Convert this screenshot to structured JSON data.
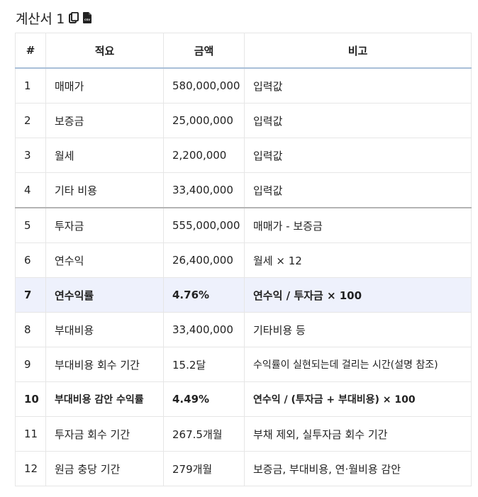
{
  "title": "계산서 1",
  "icons": {
    "copy": "copy-icon",
    "csv": "csv-file-icon",
    "csv_text": "CSV"
  },
  "columns": [
    "#",
    "적요",
    "금액",
    "비고"
  ],
  "rows": [
    {
      "no": "1",
      "item": "매매가",
      "amount": "580,000,000",
      "note": "입력값"
    },
    {
      "no": "2",
      "item": "보증금",
      "amount": "25,000,000",
      "note": "입력값"
    },
    {
      "no": "3",
      "item": "월세",
      "amount": "2,200,000",
      "note": "입력값"
    },
    {
      "no": "4",
      "item": "기타 비용",
      "amount": "33,400,000",
      "note": "입력값"
    },
    {
      "no": "5",
      "item": "투자금",
      "amount": "555,000,000",
      "note": "매매가 - 보증금"
    },
    {
      "no": "6",
      "item": "연수익",
      "amount": "26,400,000",
      "note": "월세 × 12"
    },
    {
      "no": "7",
      "item": "연수익률",
      "amount": "4.76%",
      "note": "연수익 / 투자금 × 100"
    },
    {
      "no": "8",
      "item": "부대비용",
      "amount": "33,400,000",
      "note": "기타비용 등"
    },
    {
      "no": "9",
      "item": "부대비용 회수 기간",
      "amount": "15.2달",
      "note": "수익률이 실현되는데 걸리는 시간(설명 참조)"
    },
    {
      "no": "10",
      "item": "부대비용 감안 수익률",
      "amount": "4.49%",
      "note": "연수익 / (투자금 + 부대비용) × 100"
    },
    {
      "no": "11",
      "item": "투자금 회수 기간",
      "amount": "267.5개월",
      "note": "부채 제외, 실투자금 회수 기간"
    },
    {
      "no": "12",
      "item": "원금 충당 기간",
      "amount": "279개월",
      "note": "보증금, 부대비용, 연·월비용 감안"
    }
  ],
  "colors": {
    "highlight_row": "#eef1fc",
    "header_underline": "#a9bfd8",
    "border": "#e6e6e6",
    "section_divider": "#b4b4b4"
  }
}
